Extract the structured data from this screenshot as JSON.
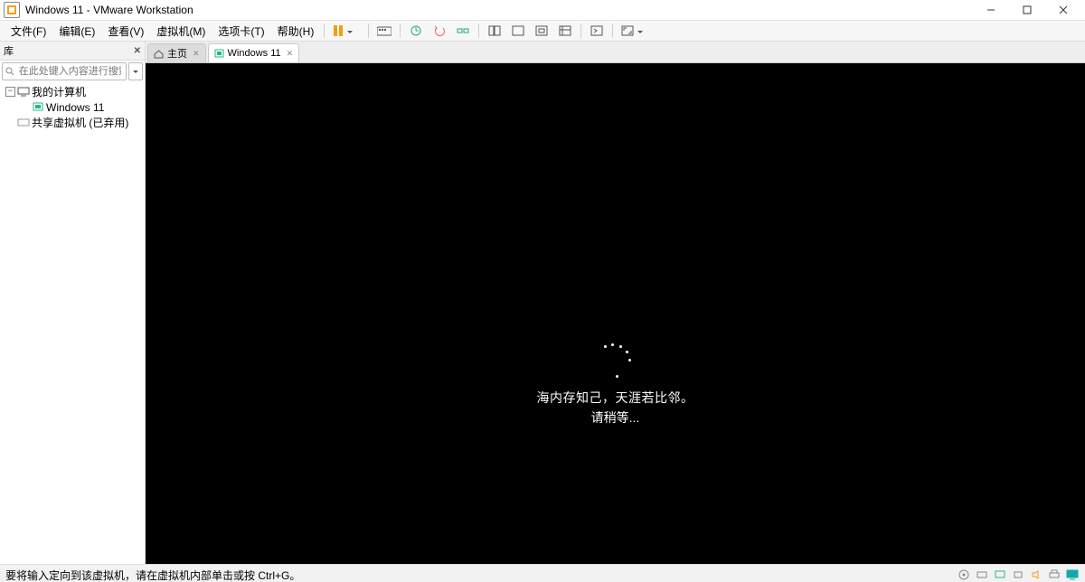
{
  "title": "Windows 11 - VMware Workstation",
  "menu": {
    "file": "文件(F)",
    "edit": "编辑(E)",
    "view": "查看(V)",
    "vm": "虚拟机(M)",
    "tabs": "选项卡(T)",
    "help": "帮助(H)"
  },
  "sidebar": {
    "title": "库",
    "search_placeholder": "在此处键入内容进行搜索",
    "tree": {
      "root": "我的计算机",
      "child": "Windows 11",
      "shared": "共享虚拟机 (已弃用)"
    }
  },
  "tabs": {
    "home": "主页",
    "vm": "Windows 11"
  },
  "loading": {
    "line1": "海内存知己，天涯若比邻。",
    "line2": "请稍等..."
  },
  "statusbar": {
    "message": "要将输入定向到该虚拟机，请在虚拟机内部单击或按 Ctrl+G。"
  }
}
